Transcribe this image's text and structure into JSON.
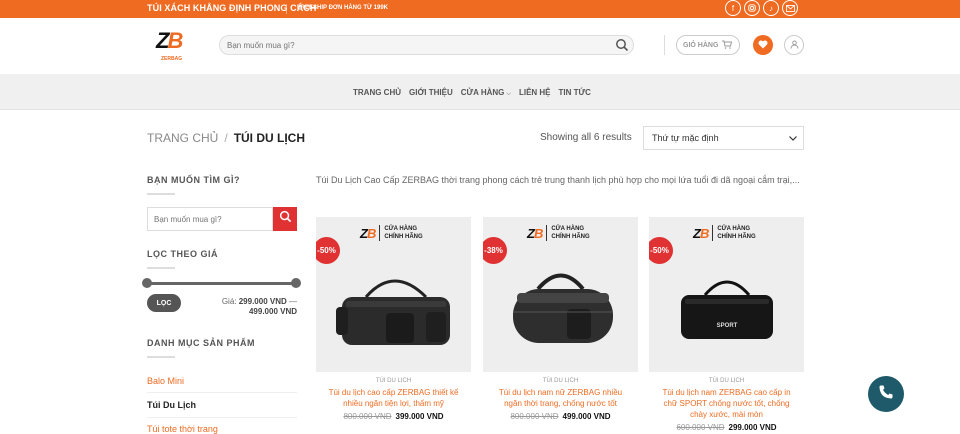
{
  "topbar": {
    "promo": "TÚI XÁCH KHẲNG ĐỊNH PHONG CÁCH",
    "shipping": "FREESHIP ĐƠN HÀNG TỪ 199K",
    "social": [
      "facebook-icon",
      "instagram-icon",
      "tiktok-icon",
      "email-icon"
    ]
  },
  "header": {
    "logo_text": "ZB",
    "logo_tag": "ZERBAG",
    "search_placeholder": "Bạn muốn mua gì?",
    "cart_label": "GIỎ HÀNG"
  },
  "nav": {
    "items": [
      "TRANG CHỦ",
      "GIỚI THIỆU",
      "CỬA HÀNG",
      "LIÊN HỆ",
      "TIN TỨC"
    ]
  },
  "breadcrumb": {
    "home": "TRANG CHỦ",
    "separator": "/",
    "current": "TÚI DU LỊCH"
  },
  "results": {
    "showing": "Showing all 6 results",
    "sort_selected": "Thứ tự mặc định"
  },
  "sidebar": {
    "search_title": "BẠN MUỐN TÌM GÌ?",
    "search_placeholder": "Bạn muốn mua gì?",
    "filter_title": "LỌC THEO GIÁ",
    "filter_button": "LỌC",
    "price_label": "Giá:",
    "price_min": "299.000 VND",
    "price_dash": "—",
    "price_max": "499.000 VND",
    "category_title": "DANH MỤC SẢN PHẨM",
    "categories": [
      {
        "label": "Balo Mini",
        "color": "#ef6b22"
      },
      {
        "label": "Túi Du Lịch",
        "color": "#222222"
      },
      {
        "label": "Túi tote thời trang",
        "color": "#ef6b22"
      }
    ]
  },
  "content": {
    "description": "Túi Du Lịch Cao Cấp ZERBAG thời trang phong cách trẻ trung thanh lịch phù hợp cho mọi lứa tuổi đi dã ngoại cắm trại,...",
    "products": [
      {
        "badge": "-50%",
        "store_line1": "CỬA HÀNG",
        "store_line2": "CHÍNH HÃNG",
        "category": "TÚI DU LỊCH",
        "title": "Túi du lịch cao cấp ZERBAG thiết kế nhiều ngăn tiện lợi, thấm mỹ",
        "old_price": "800.000 VND",
        "price": "399.000 VND"
      },
      {
        "badge": "-38%",
        "store_line1": "CỬA HÀNG",
        "store_line2": "CHÍNH HÃNG",
        "category": "TÚI DU LỊCH",
        "title": "Túi du lịch nam nữ ZERBAG nhiều ngăn thời trang, chống nước tốt",
        "old_price": "800.000 VND",
        "price": "499.000 VND"
      },
      {
        "badge": "-50%",
        "store_line1": "CỬA HÀNG",
        "store_line2": "CHÍNH HÃNG",
        "category": "TÚI DU LỊCH",
        "title": "Túi du lịch nam ZERBAG cao cấp in chữ SPORT chống nước tốt, chống chày xước, mài mòn",
        "old_price": "600.000 VND",
        "price": "299.000 VND"
      }
    ]
  },
  "colors": {
    "accent": "#ef6b22",
    "sale": "#e03233",
    "fab": "#1e5a69"
  }
}
